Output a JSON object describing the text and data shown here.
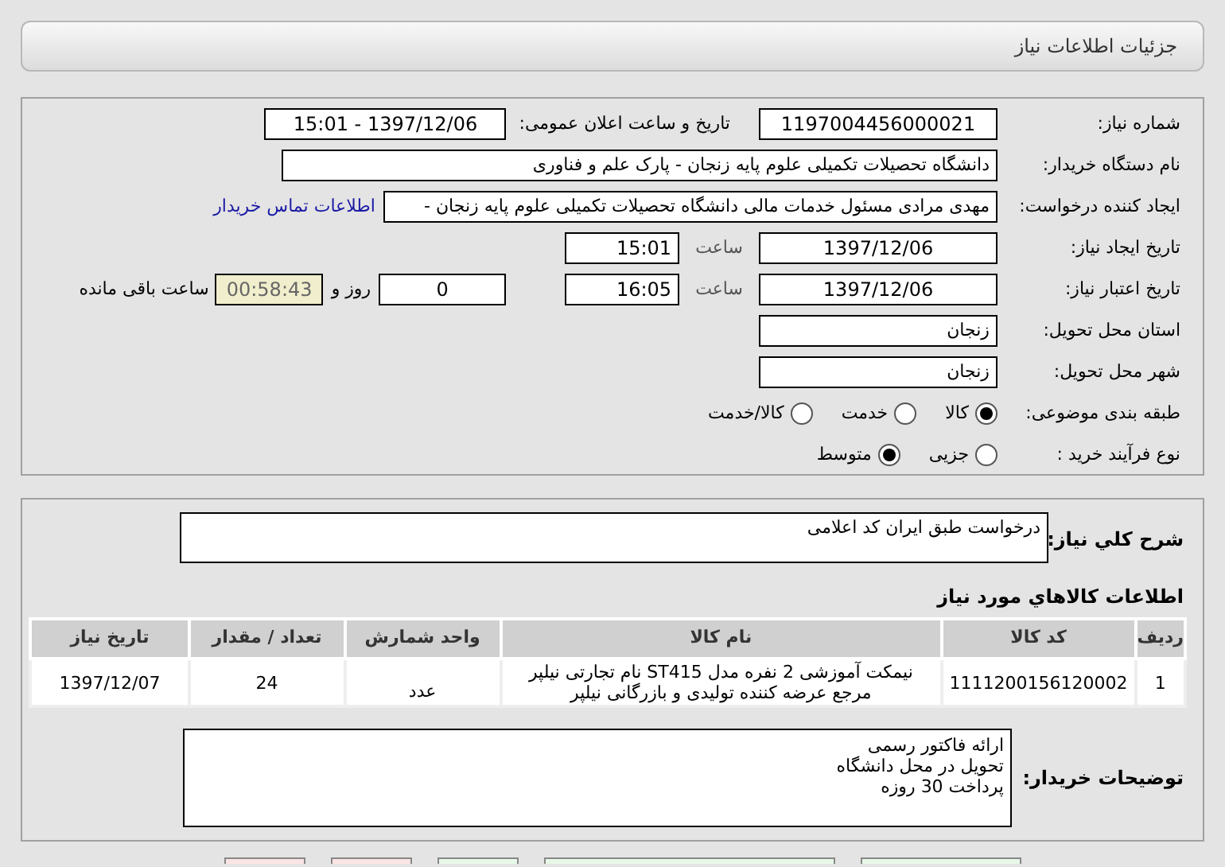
{
  "header": {
    "title": "جزئیات اطلاعات نیاز"
  },
  "need_info": {
    "need_number": {
      "label": "شماره نیاز:",
      "value": "1197004456000021"
    },
    "announce": {
      "label": "تاریخ و ساعت اعلان عمومی:",
      "value": "1397/12/06 - 15:01"
    },
    "buyer_org": {
      "label": "نام دستگاه خریدار:",
      "value": "دانشگاه تحصیلات تکمیلی علوم پایه زنجان - پارک علم و فناوری"
    },
    "requester": {
      "label": "ایجاد کننده درخواست:",
      "value": "مهدی مرادی مسئول خدمات مالی دانشگاه تحصیلات تکمیلی علوم پایه زنجان -",
      "link": "اطلاعات تماس خریدار"
    },
    "created": {
      "label": "تاریخ ایجاد نیاز:",
      "date": "1397/12/06",
      "time_label": "ساعت",
      "time": "15:01"
    },
    "validity": {
      "label": "تاریخ اعتبار نیاز:",
      "date": "1397/12/06",
      "time_label": "ساعت",
      "time": "16:05",
      "days": "0",
      "days_label": "روز و",
      "remaining": "00:58:43",
      "remaining_label": "ساعت باقی مانده"
    },
    "province": {
      "label": "استان محل تحویل:",
      "value": "زنجان"
    },
    "city": {
      "label": "شهر محل تحویل:",
      "value": "زنجان"
    },
    "category": {
      "label": "طبقه بندی موضوعی:",
      "options": [
        {
          "label": "کالا",
          "selected": true
        },
        {
          "label": "خدمت",
          "selected": false
        },
        {
          "label": "کالا/خدمت",
          "selected": false
        }
      ]
    },
    "purchase_type": {
      "label": "نوع فرآیند خرید :",
      "options": [
        {
          "label": "جزیی",
          "selected": false
        },
        {
          "label": "متوسط",
          "selected": true
        }
      ]
    }
  },
  "details": {
    "description_label": "شرح کلي نياز:",
    "description": "درخواست طبق ایران کد اعلامی",
    "items_title": "اطلاعات کالاهاي مورد نياز",
    "table": {
      "columns": [
        "رديف",
        "کد کالا",
        "نام کالا",
        "واحد شمارش",
        "تعداد / مقدار",
        "تاريخ نياز"
      ],
      "rows": [
        [
          "1",
          "1111200156120002",
          "نیمکت آموزشی 2 نفره مدل ST415 نام تجارتی نیلپر مرجع عرضه کننده تولیدی و بازرگانی نیلپر",
          "عدد",
          "24",
          "1397/12/07"
        ]
      ]
    },
    "buyer_notes_label": "توضیحات خریدار:",
    "buyer_notes": [
      "ارائه فاکتور رسمی",
      "تحویل در محل دانشگاه",
      "پرداخت 30 روزه"
    ]
  },
  "buttons": [
    {
      "color": "#e8f8e8"
    },
    {
      "color": "#e8f8e8"
    },
    {
      "color": "#e8f8e8"
    },
    {
      "color": "#fde4e4"
    },
    {
      "color": "#fde4e4"
    }
  ]
}
